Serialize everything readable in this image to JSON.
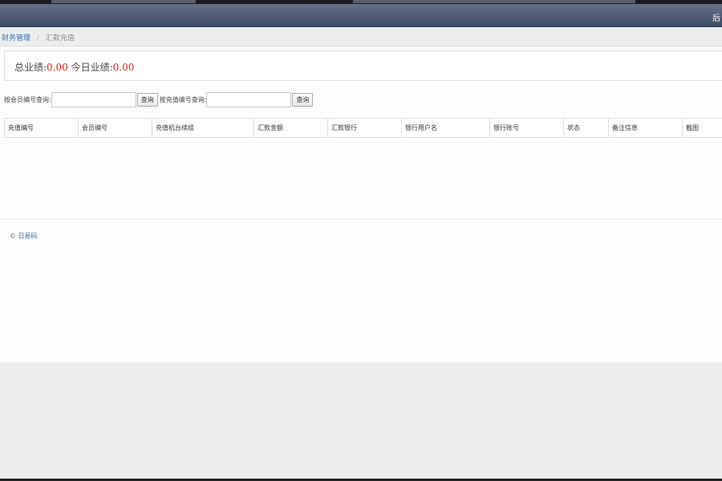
{
  "header": {
    "title": "后"
  },
  "breadcrumb": {
    "parent": "财务管理",
    "separator": "/",
    "current": "汇款充值"
  },
  "stats": {
    "total_label": "总业绩:",
    "total_value": "0.00",
    "today_label": "今日业绩:",
    "today_value": "0.00"
  },
  "search": {
    "member_label": "按会员编号查询:",
    "member_value": "",
    "recharge_label": "按充值编号查询:",
    "recharge_value": "",
    "query_button": "查询"
  },
  "table": {
    "columns": [
      "充值编号",
      "会员编号",
      "充值机台续组",
      "汇款金额",
      "汇款银行",
      "银行用户名",
      "银行账号",
      "状态",
      "备注信息",
      "截图"
    ],
    "rows": []
  },
  "footer": {
    "prefix": "© ",
    "link": "日易码"
  },
  "colors": {
    "accent_link": "#2a73b8",
    "value_red": "#e02020",
    "header_bg": "#4f5b74"
  }
}
